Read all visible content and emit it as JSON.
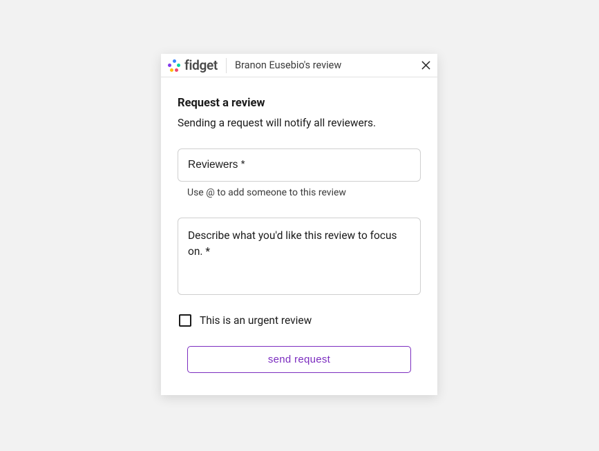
{
  "header": {
    "app_name": "fidget",
    "title": "Branon Eusebio's review"
  },
  "content": {
    "title": "Request a review",
    "subtitle": "Sending a request will notify all reviewers."
  },
  "fields": {
    "reviewers": {
      "placeholder": "Reviewers *",
      "helper": "Use @ to add someone to this review",
      "value": ""
    },
    "description": {
      "placeholder": "Describe what you'd like this review to focus on. *",
      "value": ""
    },
    "urgent": {
      "label": "This is an urgent review",
      "checked": false
    }
  },
  "actions": {
    "submit": "send request"
  }
}
